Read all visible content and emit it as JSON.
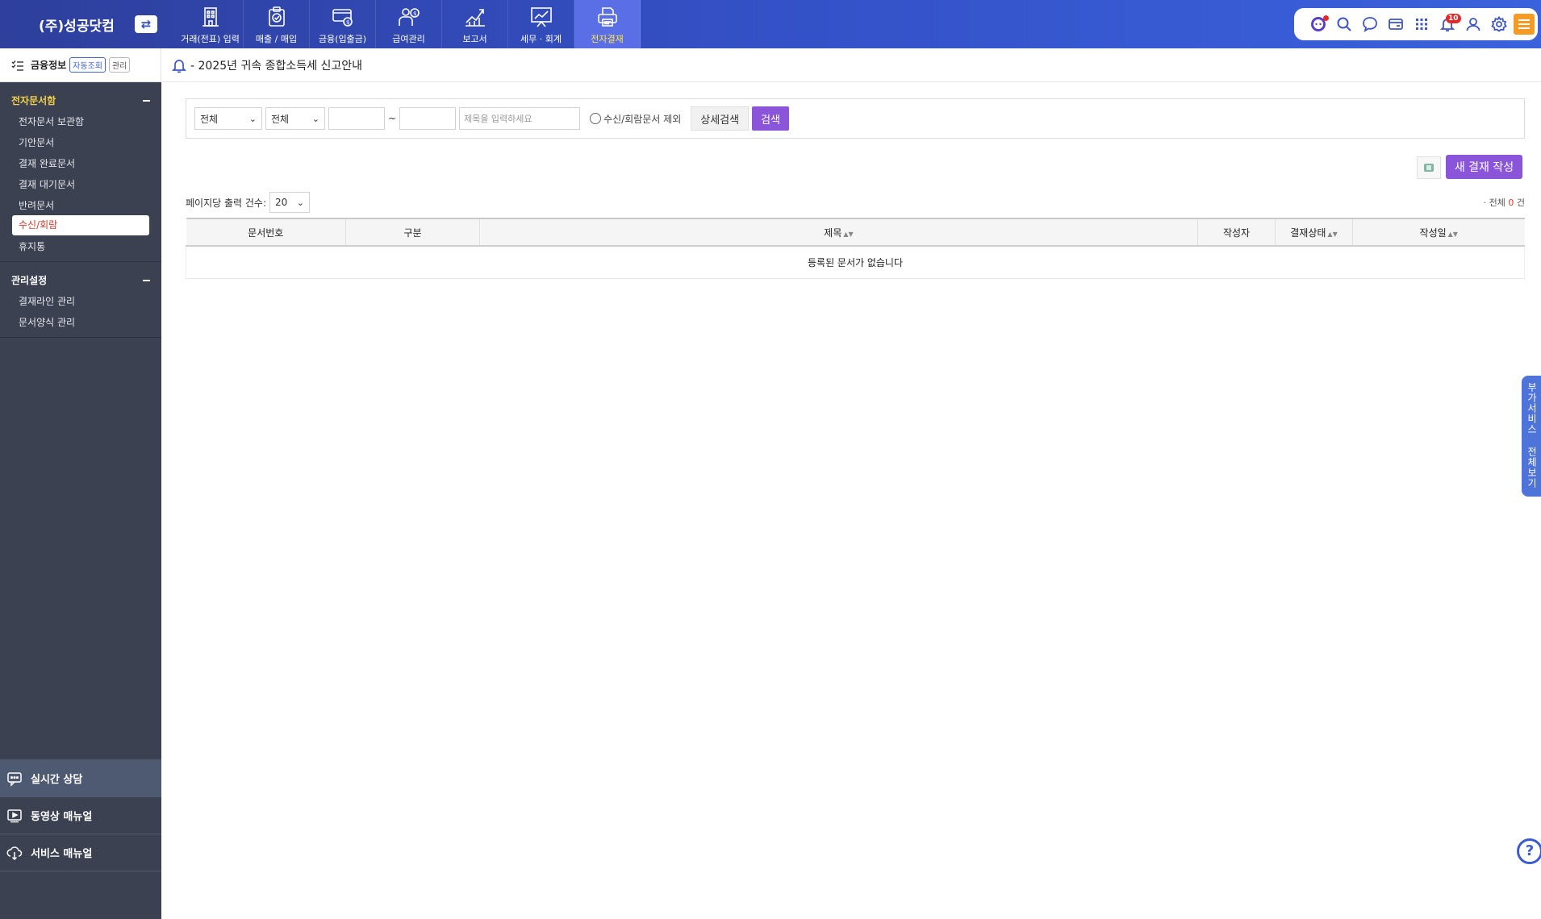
{
  "app": {
    "brand": "(주)성공닷컴"
  },
  "nav": [
    {
      "label": "거래(전표) 입력",
      "icon": "building-icon"
    },
    {
      "label": "매출 / 매입",
      "icon": "clipboard-check-icon"
    },
    {
      "label": "금융(입출금)",
      "icon": "card-coin-icon"
    },
    {
      "label": "급여관리",
      "icon": "person-coin-icon"
    },
    {
      "label": "보고서",
      "icon": "chart-up-icon"
    },
    {
      "label": "세무 · 회계",
      "icon": "presentation-icon"
    },
    {
      "label": "전자결재",
      "icon": "printer-document-icon",
      "active": true
    }
  ],
  "util": {
    "notification_count": "10"
  },
  "sidebar": {
    "header_title": "금융정보",
    "tag_auto": "자동조회",
    "tag_manage": "관리",
    "groups": [
      {
        "title": "전자문서함",
        "items": [
          "전자문서 보관함",
          "기안문서",
          "결재 완료문서",
          "결재 대기문서",
          "반려문서",
          "수신/회람",
          "휴지통"
        ],
        "active_index": 5
      },
      {
        "title": "관리설정",
        "items": [
          "결재라인 관리",
          "문서양식 관리"
        ]
      }
    ],
    "bottom": [
      {
        "label": "실시간 상담",
        "icon": "chat-icon"
      },
      {
        "label": "동영상 매뉴얼",
        "icon": "video-icon"
      },
      {
        "label": "서비스 매뉴얼",
        "icon": "cloud-download-icon"
      }
    ]
  },
  "notice": {
    "text": "- 2025년 귀속 종합소득세 신고안내"
  },
  "search": {
    "select1": "전체",
    "select2": "전체",
    "tilde": "~",
    "title_placeholder": "제목을 입력하세요",
    "exclude_label": "수신/회람문서 제외",
    "detail_label": "상세검색",
    "search_label": "검색"
  },
  "actions": {
    "new_label": "새 결재 작성"
  },
  "list": {
    "perpage_label": "페이지당 출력 건수:",
    "perpage_value": "20",
    "total_prefix": "· 전체",
    "total_count": "0",
    "total_suffix": "건",
    "columns": [
      "문서번호",
      "구분",
      "제목",
      "작성자",
      "결재상태",
      "작성일"
    ],
    "empty_message": "등록된 문서가 없습니다"
  },
  "side_tab": {
    "text": "부가서비스 전체보기"
  },
  "colors": {
    "brand": "#3451c7",
    "accent": "#8a55d8",
    "sidebar": "#3b4151",
    "highlight": "#f2d04b",
    "active_text": "#e4362b"
  }
}
